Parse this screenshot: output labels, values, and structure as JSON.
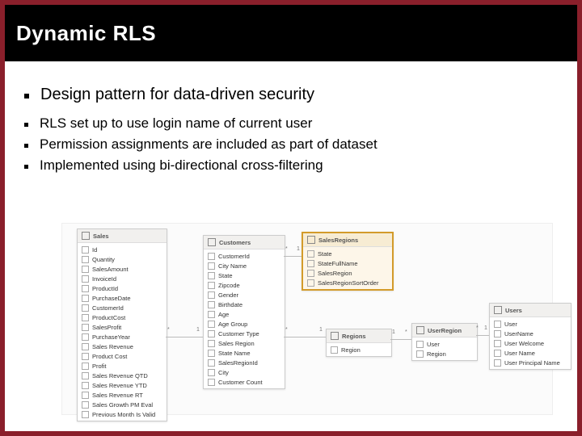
{
  "title": "Dynamic RLS",
  "bullet_main": "Design pattern for data-driven security",
  "sub_bullets": [
    "RLS set up to use login name of current user",
    "Permission assignments are included as part of dataset",
    "Implemented using bi-directional cross-filtering"
  ],
  "entities": {
    "sales": {
      "name": "Sales",
      "fields": [
        "Id",
        "Quantity",
        "SalesAmount",
        "InvoiceId",
        "ProductId",
        "PurchaseDate",
        "CustomerId",
        "ProductCost",
        "SalesProfit",
        "PurchaseYear",
        "Sales Revenue",
        "Product Cost",
        "Profit",
        "Sales Revenue QTD",
        "Sales Revenue YTD",
        "Sales Revenue RT",
        "Sales Growth PM Eval",
        "Previous Month Is Valid"
      ]
    },
    "customers": {
      "name": "Customers",
      "fields": [
        "CustomerId",
        "City Name",
        "State",
        "Zipcode",
        "Gender",
        "Birthdate",
        "Age",
        "Age Group",
        "Customer Type",
        "Sales Region",
        "State Name",
        "SalesRegionId",
        "City",
        "Customer Count"
      ]
    },
    "salesregions": {
      "name": "SalesRegions",
      "fields": [
        "State",
        "StateFullName",
        "SalesRegion",
        "SalesRegionSortOrder"
      ]
    },
    "regions": {
      "name": "Regions",
      "fields": [
        "Region"
      ]
    },
    "userregion": {
      "name": "UserRegion",
      "fields": [
        "User",
        "Region"
      ]
    },
    "users": {
      "name": "Users",
      "fields": [
        "User",
        "UserName",
        "User Welcome",
        "User Name",
        "User Principal Name"
      ]
    }
  }
}
